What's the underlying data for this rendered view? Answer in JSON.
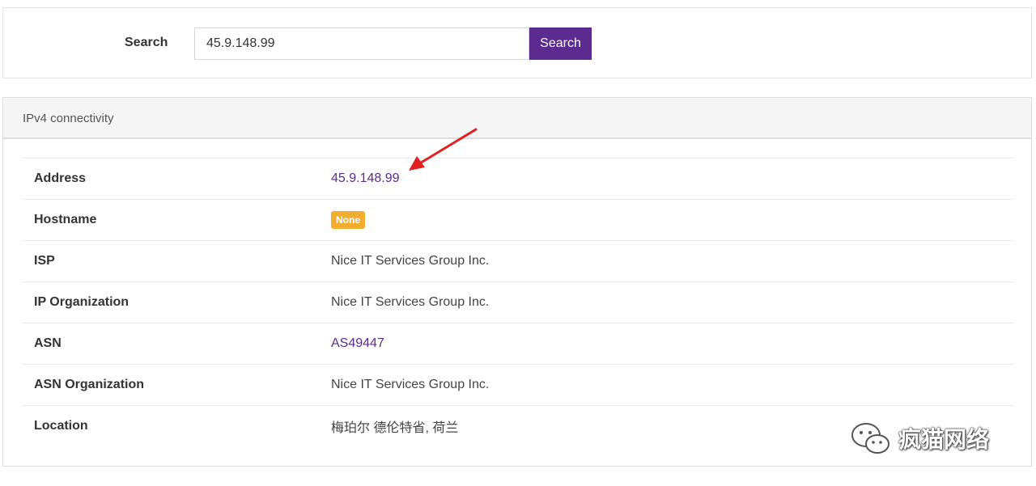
{
  "search": {
    "label": "Search",
    "value": "45.9.148.99",
    "button_label": "Search",
    "button_color": "#5b2b8f"
  },
  "results": {
    "header": "IPv4 connectivity",
    "rows": [
      {
        "key": "Address",
        "value": "45.9.148.99",
        "type": "link"
      },
      {
        "key": "Hostname",
        "value": "None",
        "type": "badge"
      },
      {
        "key": "ISP",
        "value": "Nice IT Services Group Inc.",
        "type": "text"
      },
      {
        "key": "IP Organization",
        "value": "Nice IT Services Group Inc.",
        "type": "text"
      },
      {
        "key": "ASN",
        "value": "AS49447",
        "type": "link"
      },
      {
        "key": "ASN Organization",
        "value": "Nice IT Services Group Inc.",
        "type": "text"
      },
      {
        "key": "Location",
        "value": "梅珀尔 德伦特省, 荷兰",
        "type": "text"
      }
    ]
  },
  "annotation": {
    "arrow_color": "#e02020",
    "arrow_icon": "red-arrow-icon"
  },
  "watermark": {
    "icon": "wechat-icon",
    "text": "疯猫网络"
  },
  "colors": {
    "accent": "#5b2b8f",
    "badge": "#f0ad2e"
  }
}
